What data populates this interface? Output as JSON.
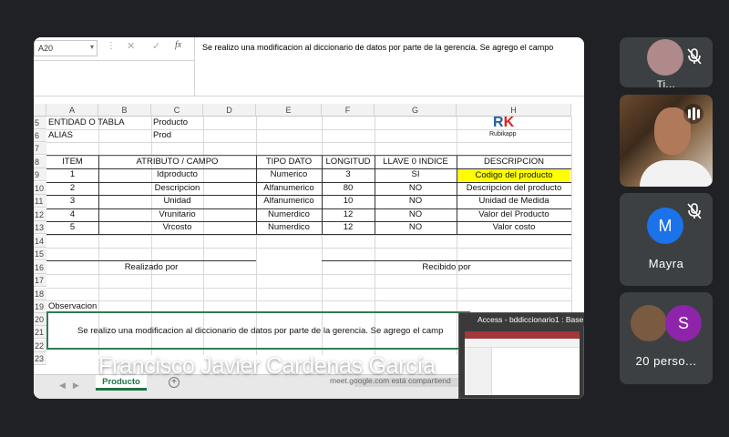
{
  "formula_bar": {
    "name_box": "A20",
    "fx": "fx",
    "content": "Se realizo una modificacion al diccionario de datos por parte de la gerencia. Se agrego el campo"
  },
  "sheet": {
    "columns": [
      "A",
      "B",
      "C",
      "D",
      "E",
      "F",
      "G",
      "H"
    ],
    "rows": [
      "5",
      "6",
      "7",
      "8",
      "9",
      "10",
      "11",
      "12",
      "13",
      "14",
      "15",
      "16",
      "17",
      "18",
      "19",
      "20",
      "21",
      "22",
      "23"
    ],
    "entidad_label": "ENTIDAD O TABLA",
    "entidad_value": "Producto",
    "alias_label": "ALIAS",
    "alias_value": "Prod",
    "logo_text": "Rubikapp",
    "headers": [
      "ITEM",
      "ATRIBUTO / CAMPO",
      "TIPO DATO",
      "LONGITUD",
      "LLAVE 0 INDICE",
      "DESCRIPCION"
    ],
    "table": [
      [
        "1",
        "Idproducto",
        "Numerico",
        "3",
        "SI",
        "Codigo del producto"
      ],
      [
        "2",
        "Descripcion",
        "Alfanumerico",
        "80",
        "NO",
        "Descripcion del producto"
      ],
      [
        "3",
        "Unidad",
        "Alfanumerico",
        "10",
        "NO",
        "Unidad de Medida"
      ],
      [
        "4",
        "Vrunitario",
        "Numerdico",
        "12",
        "NO",
        "Valor del Producto"
      ],
      [
        "5",
        "Vrcosto",
        "Numerdico",
        "12",
        "NO",
        "Valor costo"
      ]
    ],
    "highlight_color": "#ffff00",
    "realizado_por": "Realizado por",
    "recibido_por": "Recibido por",
    "observacion_label": "Observacion",
    "observacion_text": "Se realizo una modificacion al diccionario de datos por parte de la gerencia. Se agrego el camp",
    "sheet_tab": "Producto"
  },
  "access_preview": {
    "title": "Access - bddiccionario1 : Base"
  },
  "share_notice": "meet.google.com está compartiend",
  "speaker": {
    "name": "Francisco Javier Cardenas García"
  },
  "participants": [
    {
      "name": "Ti..."
    },
    {
      "name": ""
    },
    {
      "name": "Mayra",
      "initial": "M",
      "color": "#1a73e8"
    },
    {
      "name": "20 perso...",
      "initial": "S",
      "color": "#8e24aa"
    }
  ]
}
